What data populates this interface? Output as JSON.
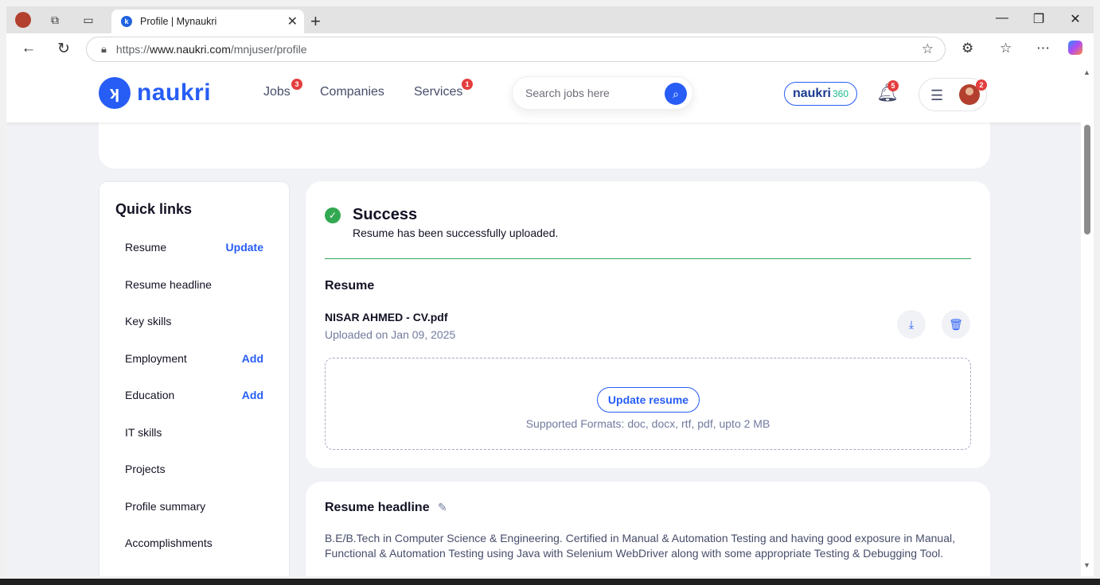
{
  "browser": {
    "tab_title": "Profile | Mynaukri",
    "url_scheme": "https://",
    "url_host": "www.naukri.com",
    "url_path": "/mnjuser/profile"
  },
  "header": {
    "logo_text": "naukri",
    "nav": {
      "jobs": "Jobs",
      "jobs_badge": "3",
      "companies": "Companies",
      "services": "Services",
      "services_badge": "1"
    },
    "search_placeholder": "Search jobs here",
    "naukri360_main": "naukri",
    "naukri360_suffix": "360",
    "notifications_badge": "5",
    "profile_badge": "2"
  },
  "quick_links": {
    "title": "Quick links",
    "items": [
      {
        "label": "Resume",
        "action": "Update"
      },
      {
        "label": "Resume headline",
        "action": ""
      },
      {
        "label": "Key skills",
        "action": ""
      },
      {
        "label": "Employment",
        "action": "Add"
      },
      {
        "label": "Education",
        "action": "Add"
      },
      {
        "label": "IT skills",
        "action": ""
      },
      {
        "label": "Projects",
        "action": ""
      },
      {
        "label": "Profile summary",
        "action": ""
      },
      {
        "label": "Accomplishments",
        "action": ""
      }
    ]
  },
  "resume_card": {
    "success_title": "Success",
    "success_message": "Resume has been successfully uploaded.",
    "section_title": "Resume",
    "file_name": "NISAR AHMED - CV.pdf",
    "uploaded_on": "Uploaded on Jan 09, 2025",
    "update_button": "Update resume",
    "formats": "Supported Formats: doc, docx, rtf, pdf, upto 2 MB"
  },
  "headline_card": {
    "title": "Resume headline",
    "text": "B.E/B.Tech in Computer Science & Engineering. Certified in Manual & Automation Testing and having good exposure in Manual, Functional & Automation Testing using Java with Selenium WebDriver along with some appropriate Testing & Debugging Tool."
  },
  "colors": {
    "brand_blue": "#275df5",
    "success_green": "#33a852",
    "badge_red": "#e43e3e"
  }
}
